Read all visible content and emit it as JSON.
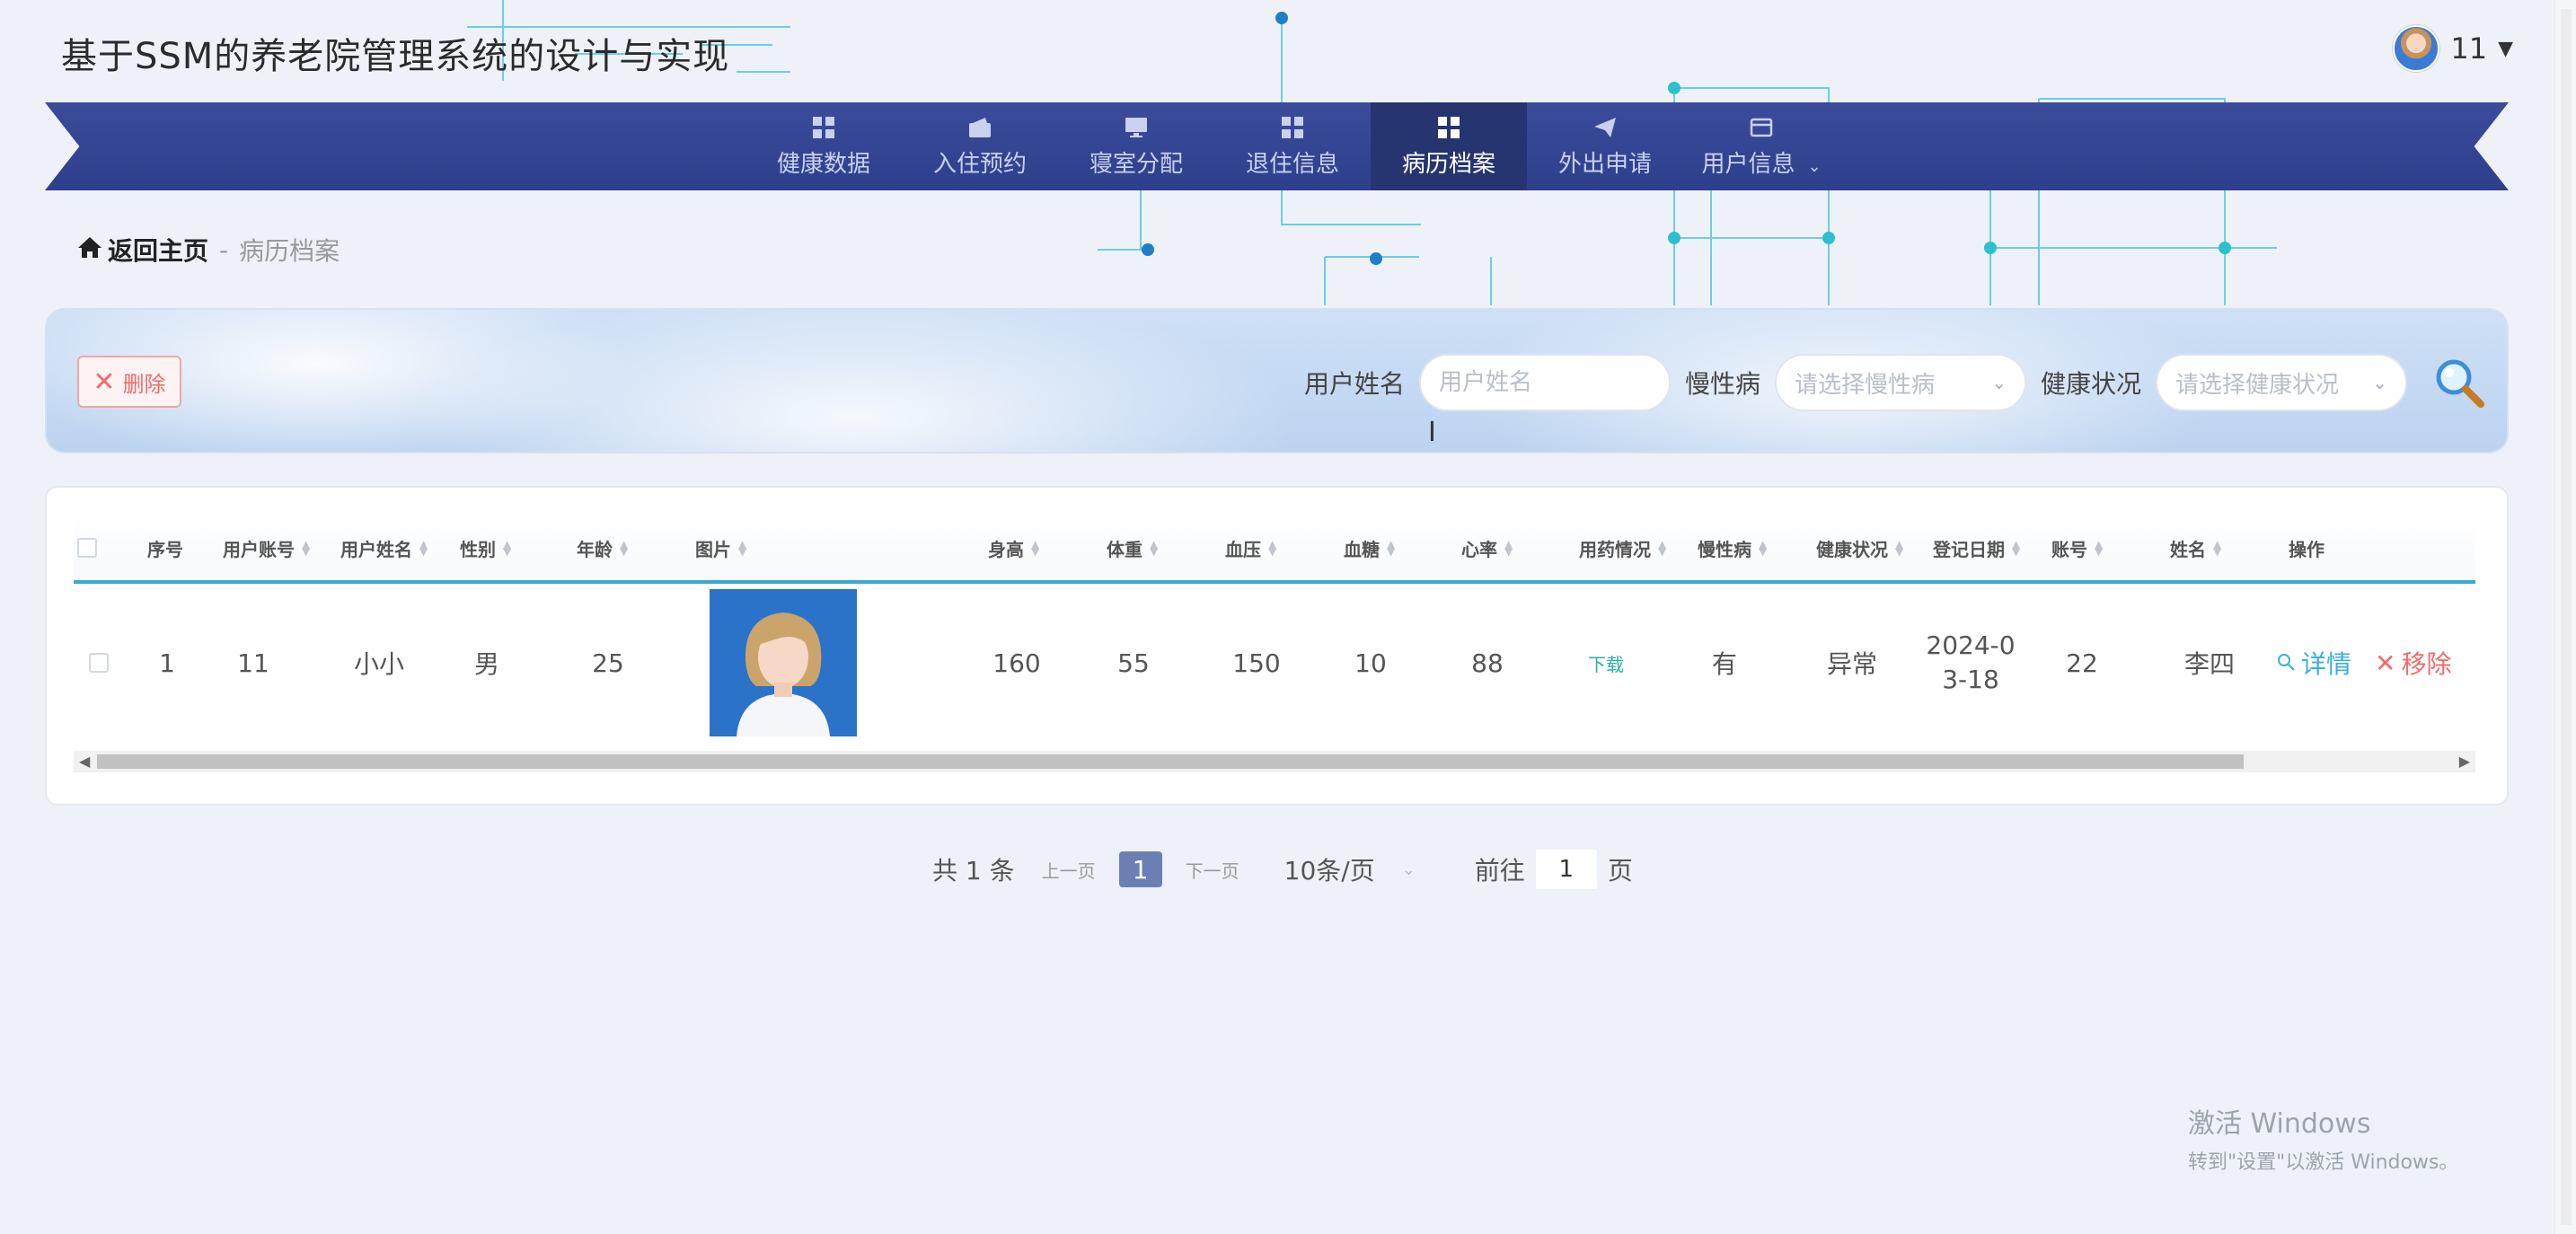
{
  "site": {
    "title": "基于SSM的养老院管理系统的设计与实现"
  },
  "user": {
    "name": "11"
  },
  "nav": {
    "items": [
      {
        "label": "健康数据",
        "icon": "grid-icon"
      },
      {
        "label": "入住预约",
        "icon": "wallet-icon"
      },
      {
        "label": "寝室分配",
        "icon": "monitor-icon"
      },
      {
        "label": "退住信息",
        "icon": "grid-icon"
      },
      {
        "label": "病历档案",
        "icon": "grid-icon",
        "active": true
      },
      {
        "label": "外出申请",
        "icon": "paper-plane-icon"
      },
      {
        "label": "用户信息",
        "icon": "card-icon"
      }
    ]
  },
  "breadcrumb": {
    "home": "返回主页",
    "separator": "-",
    "current": "病历档案"
  },
  "toolbar": {
    "delete_label": "删除"
  },
  "search": {
    "name_label": "用户姓名",
    "name_placeholder": "用户姓名",
    "chronic_label": "慢性病",
    "chronic_placeholder": "请选择慢性病",
    "health_label": "健康状况",
    "health_placeholder": "请选择健康状况"
  },
  "table": {
    "headers": [
      "序号",
      "用户账号",
      "用户姓名",
      "性别",
      "年龄",
      "图片",
      "身高",
      "体重",
      "血压",
      "血糖",
      "心率",
      "用药情况",
      "慢性病",
      "健康状况",
      "登记日期",
      "账号",
      "姓名",
      "操作"
    ],
    "rows": [
      {
        "index": "1",
        "account": "11",
        "username": "小小",
        "gender": "男",
        "age": "25",
        "height": "160",
        "weight": "55",
        "blood_pressure": "150",
        "blood_sugar": "10",
        "heart_rate": "88",
        "medication": "下载",
        "chronic": "有",
        "health": "异常",
        "date_line1": "2024-0",
        "date_line2": "3-18",
        "acct": "22",
        "name": "李四",
        "detail": "详情",
        "remove": "移除"
      }
    ]
  },
  "pagination": {
    "total": "共 1 条",
    "prev": "上一页",
    "current": "1",
    "next": "下一页",
    "page_size": "10条/页",
    "goto_label": "前往",
    "goto_value": "1",
    "goto_suffix": "页"
  },
  "watermark": {
    "line1": "激活 Windows",
    "line2": "转到\"设置\"以激活 Windows。"
  },
  "colors": {
    "nav_bg": "#2e3f8c",
    "nav_active": "#26356f",
    "accent": "#38a9cf",
    "danger": "#f26b6b",
    "pager_active": "#6c7fb5"
  }
}
